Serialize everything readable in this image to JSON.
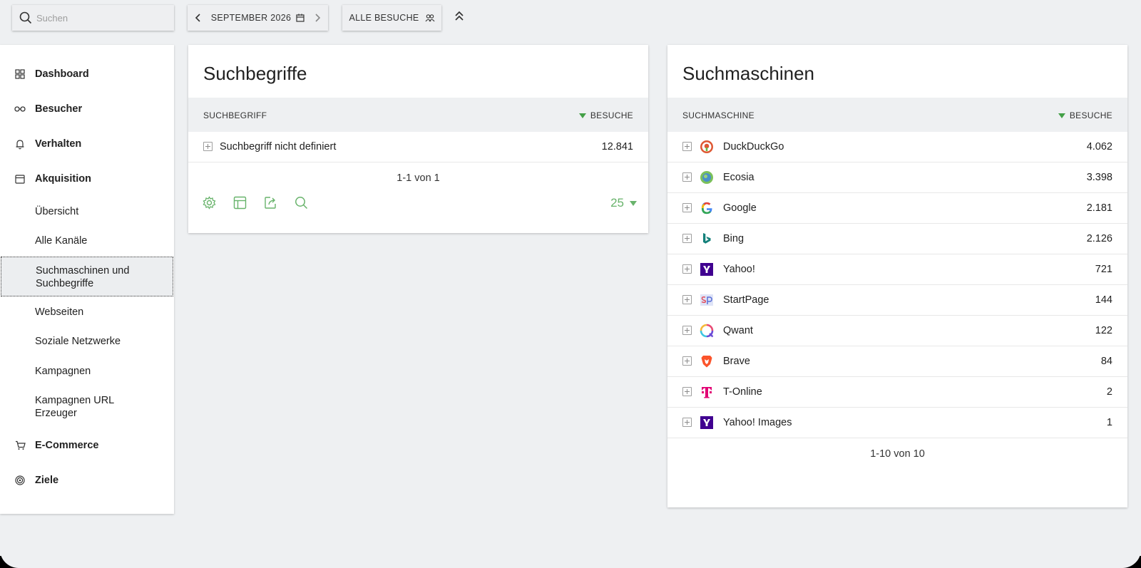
{
  "topbar": {
    "search_placeholder": "Suchen",
    "period_label": "SEPTEMBER 2026",
    "segment_label": "ALLE BESUCHE"
  },
  "sidebar": {
    "categories": {
      "dashboard": "Dashboard",
      "visitors": "Besucher",
      "behaviour": "Verhalten",
      "acquisition": "Akquisition",
      "ecommerce": "E-Commerce",
      "goals": "Ziele"
    },
    "acquisition_items": [
      "Übersicht",
      "Alle Kanäle",
      "Suchmaschinen und Suchbegriffe",
      "Webseiten",
      "Soziale Netzwerke",
      "Kampagnen",
      "Kampagnen URL Erzeuger"
    ]
  },
  "keywords_card": {
    "title": "Suchbegriffe",
    "col_label": "SUCHBEGRIFF",
    "col_value": "BESUCHE",
    "rows": [
      {
        "label": "Suchbegriff nicht definiert",
        "value": "12.841"
      }
    ],
    "pagination": "1-1 von 1",
    "limit": "25"
  },
  "engines_card": {
    "title": "Suchmaschinen",
    "col_label": "SUCHMASCHINE",
    "col_value": "BESUCHE",
    "rows": [
      {
        "label": "DuckDuckGo",
        "value": "4.062",
        "icon": "duckduckgo-icon"
      },
      {
        "label": "Ecosia",
        "value": "3.398",
        "icon": "ecosia-icon"
      },
      {
        "label": "Google",
        "value": "2.181",
        "icon": "google-icon"
      },
      {
        "label": "Bing",
        "value": "2.126",
        "icon": "bing-icon"
      },
      {
        "label": "Yahoo!",
        "value": "721",
        "icon": "yahoo-icon"
      },
      {
        "label": "StartPage",
        "value": "144",
        "icon": "startpage-icon"
      },
      {
        "label": "Qwant",
        "value": "122",
        "icon": "qwant-icon"
      },
      {
        "label": "Brave",
        "value": "84",
        "icon": "brave-icon"
      },
      {
        "label": "T-Online",
        "value": "2",
        "icon": "t-online-icon"
      },
      {
        "label": "Yahoo! Images",
        "value": "1",
        "icon": "yahoo-icon"
      }
    ],
    "pagination": "1-10 von 10"
  },
  "colors": {
    "accent_green": "#43a047",
    "limit_green": "#68b36b",
    "background": "#eef0f2"
  }
}
